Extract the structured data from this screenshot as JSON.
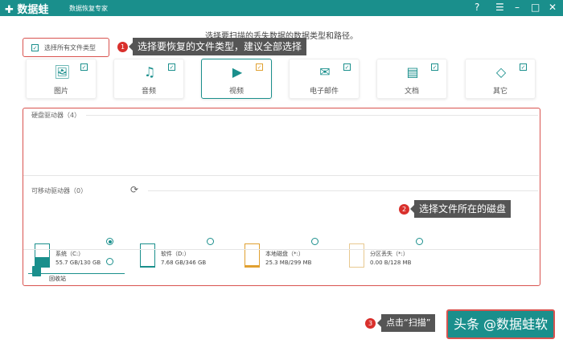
{
  "app": {
    "logo": "✚ 数据蛙",
    "subtitle": "数据恢复专家"
  },
  "window": {
    "help": "?",
    "menu": "☰",
    "minimize": "–",
    "maximize": "□",
    "close": "✕"
  },
  "hint": "选择要扫描的丢失数据的数据类型和路径。",
  "select_all": {
    "label": "选择所有文件类型",
    "checked": true
  },
  "callouts": [
    {
      "num": "1",
      "text": "选择要恢复的文件类型，建议全部选择"
    },
    {
      "num": "2",
      "text": "选择文件所在的磁盘"
    },
    {
      "num": "3",
      "text": "点击“扫描”"
    }
  ],
  "file_types": [
    {
      "label": "图片",
      "icon": "image-icon",
      "glyph": "🖼",
      "checked": true
    },
    {
      "label": "音频",
      "icon": "music-icon",
      "glyph": "♫",
      "checked": true
    },
    {
      "label": "视频",
      "icon": "video-icon",
      "glyph": "▶",
      "checked": true
    },
    {
      "label": "电子邮件",
      "icon": "mail-icon",
      "glyph": "✉",
      "checked": true
    },
    {
      "label": "文档",
      "icon": "document-icon",
      "glyph": "▤",
      "checked": true
    },
    {
      "label": "其它",
      "icon": "other-icon",
      "glyph": "◇",
      "checked": true
    }
  ],
  "hard_drives": {
    "title": "硬盘驱动器（4）",
    "items": [
      {
        "name": "系统（C:）",
        "size": "55.7 GB/130 GB",
        "selected": true,
        "fill": 0.43,
        "color": "#1a8f8c"
      },
      {
        "name": "软件（D:）",
        "size": "7.68 GB/346 GB",
        "selected": false,
        "fill": 0.02,
        "color": "#1a8f8c"
      },
      {
        "name": "本地磁盘（*:）",
        "size": "25.3 MB/299 MB",
        "selected": false,
        "fill": 0.08,
        "color": "#e0a030"
      },
      {
        "name": "分区丢失（*:）",
        "size": "0.00  B/128 MB",
        "selected": false,
        "fill": 0,
        "color": "#e8c890"
      }
    ]
  },
  "removable": {
    "title": "可移动驱动器（0）"
  },
  "recycle": {
    "label": "回收站"
  },
  "scan_button": {
    "label": "头条 @数据蛙软件"
  }
}
